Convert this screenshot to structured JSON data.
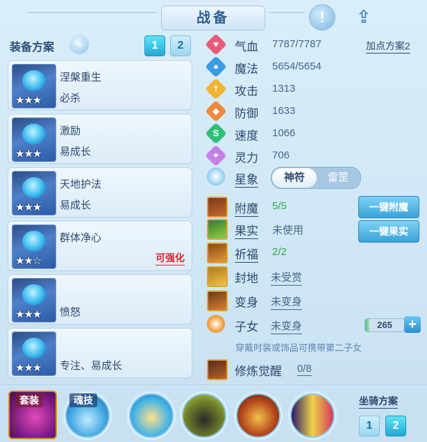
{
  "header": {
    "title": "战备"
  },
  "left": {
    "section_label": "装备方案",
    "plan_buttons": [
      "1",
      "2"
    ],
    "cards": [
      {
        "line1": "涅槃重生",
        "line2": "必杀",
        "stars": "★★★"
      },
      {
        "line1": "激励",
        "line2": "易成长",
        "stars": "★★★"
      },
      {
        "line1": "天地护法",
        "line2": "易成长",
        "stars": "★★★"
      },
      {
        "line1": "群体净心",
        "line2": "",
        "stars": "★★☆",
        "badge": "可强化"
      },
      {
        "line1": "",
        "line2": "愤怒",
        "stars": "★★★"
      },
      {
        "line1": "",
        "line2": "专注、易成长",
        "stars": "★★★"
      }
    ]
  },
  "stats": [
    {
      "name": "气血",
      "value": "7787/7787",
      "color": "#e8597a",
      "glyph": "♥"
    },
    {
      "name": "魔法",
      "value": "5654/5654",
      "color": "#3a9be0",
      "glyph": "●"
    },
    {
      "name": "攻击",
      "value": "1313",
      "color": "#f0b432",
      "glyph": "†"
    },
    {
      "name": "防御",
      "value": "1633",
      "color": "#f08a3a",
      "glyph": "◆"
    },
    {
      "name": "速度",
      "value": "1066",
      "color": "#2fbf79",
      "glyph": "S"
    },
    {
      "name": "灵力",
      "value": "706",
      "color": "#c580e8",
      "glyph": "✦"
    }
  ],
  "add_point_plan": "加点方案2",
  "star_sign": {
    "label": "星象",
    "options": [
      "神符",
      "雷罡"
    ],
    "selected": "神符"
  },
  "extras": [
    {
      "name": "附魔",
      "value": "5/5",
      "green": true
    },
    {
      "name": "果实",
      "value": "未使用",
      "green": false
    },
    {
      "name": "祈福",
      "value": "2/2",
      "green": true
    },
    {
      "name": "封地",
      "value": "未受赏",
      "green": false
    },
    {
      "name": "变身",
      "value": "未变身",
      "green": false
    },
    {
      "name": "子女",
      "value": "未变身",
      "green": false
    }
  ],
  "buttons": {
    "enchant": "一键附魔",
    "fruit": "一键果实"
  },
  "child": {
    "points": "265",
    "fill_fraction": 0.1
  },
  "hint": "穿戴时装或饰品可携带第二子女",
  "cultivation": {
    "name": "修炼觉醒",
    "value": "0/8"
  },
  "bottom": {
    "suit_tag": "套装",
    "soul_tag": "魂技",
    "mount_label": "坐骑方案",
    "mount_buttons": [
      "1",
      "2"
    ]
  },
  "colors": {
    "accent": "#22a9d4",
    "badge": "#d22a2a",
    "green_value": "#2fa845"
  }
}
